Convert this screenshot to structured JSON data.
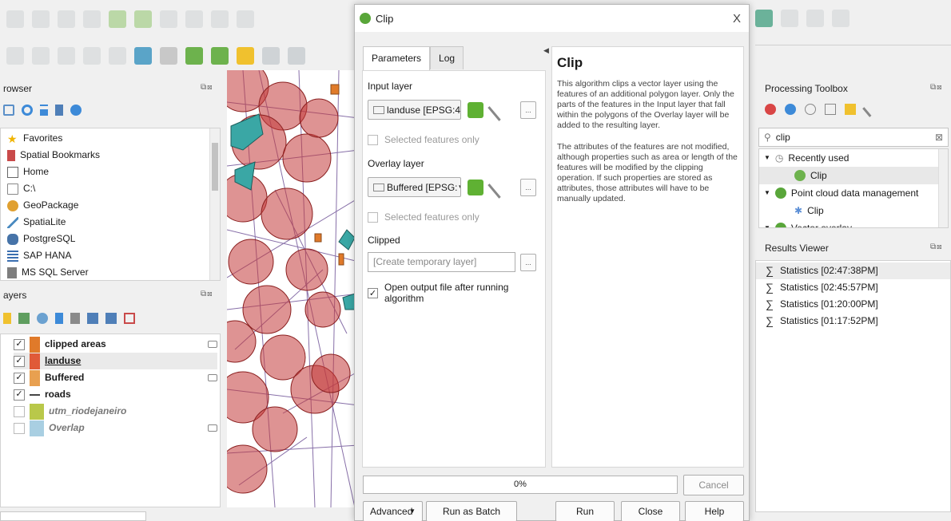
{
  "browser": {
    "title": "rowser",
    "items": [
      {
        "label": "Favorites",
        "icon": "star-icon"
      },
      {
        "label": "Spatial Bookmarks",
        "icon": "bookmark-icon"
      },
      {
        "label": "Home",
        "icon": "home-icon"
      },
      {
        "label": "C:\\",
        "icon": "folder-icon"
      },
      {
        "label": "GeoPackage",
        "icon": "geopackage-icon"
      },
      {
        "label": "SpatiaLite",
        "icon": "spatialite-icon"
      },
      {
        "label": "PostgreSQL",
        "icon": "postgresql-icon"
      },
      {
        "label": "SAP HANA",
        "icon": "sap-hana-icon"
      },
      {
        "label": "MS SQL Server",
        "icon": "mssql-icon"
      }
    ]
  },
  "layers": {
    "title": "ayers",
    "items": [
      {
        "label": "clipped areas",
        "checked": true,
        "color": "#e07a2a",
        "underline": false
      },
      {
        "label": "landuse",
        "checked": true,
        "color": "#e05a38",
        "underline": true
      },
      {
        "label": "Buffered",
        "checked": true,
        "color": "#e8a050",
        "underline": false
      },
      {
        "label": "roads",
        "checked": true,
        "color": "#6a4c93",
        "underline": false
      },
      {
        "label": "utm_riodejaneiro",
        "checked": false,
        "color": "#b9c84a",
        "underline": false
      },
      {
        "label": "Overlap",
        "checked": false,
        "color": "#a9cfe2",
        "underline": false
      }
    ]
  },
  "dialog": {
    "title": "Clip",
    "tabs": [
      "Parameters",
      "Log"
    ],
    "input_layer_label": "Input layer",
    "input_layer_value": "landuse [EPSG:4",
    "selected_only_1": "Selected features only",
    "overlay_layer_label": "Overlay layer",
    "overlay_layer_value": "Buffered [EPSG:",
    "selected_only_2": "Selected features only",
    "clipped_label": "Clipped",
    "clipped_placeholder": "[Create temporary layer]",
    "open_output_label": "Open output file after running algorithm",
    "help_title": "Clip",
    "help_p1": "This algorithm clips a vector layer using the features of an additional polygon layer. Only the parts of the features in the Input layer that fall within the polygons of the Overlay layer will be added to the resulting layer.",
    "help_p2": "The attributes of the features are not modified, although properties such as area or length of the features will be modified by the clipping operation. If such properties are stored as attributes, those attributes will have to be manually updated.",
    "progress_text": "0%",
    "progress_fraction": 0,
    "cancel": "Cancel",
    "advanced": "Advanced",
    "batch": "Run as Batch Process...",
    "run": "Run",
    "close": "Close",
    "help": "Help",
    "close_x": "X"
  },
  "toolbox": {
    "title": "Processing Toolbox",
    "search_value": "clip",
    "tree": [
      {
        "label": "Recently used",
        "level": 0,
        "icon": "clock-icon"
      },
      {
        "label": "Clip",
        "level": 1,
        "icon": "clip-tool-icon"
      },
      {
        "label": "Point cloud data management",
        "level": 0,
        "icon": "qgis-icon"
      },
      {
        "label": "Clip",
        "level": 1,
        "icon": "gear-icon"
      },
      {
        "label": "Vector overlay",
        "level": 0,
        "icon": "qgis-icon"
      }
    ]
  },
  "results": {
    "title": "Results Viewer",
    "items": [
      "Statistics [02:47:38PM]",
      "Statistics [02:45:57PM]",
      "Statistics [01:20:00PM]",
      "Statistics [01:17:52PM]"
    ]
  }
}
